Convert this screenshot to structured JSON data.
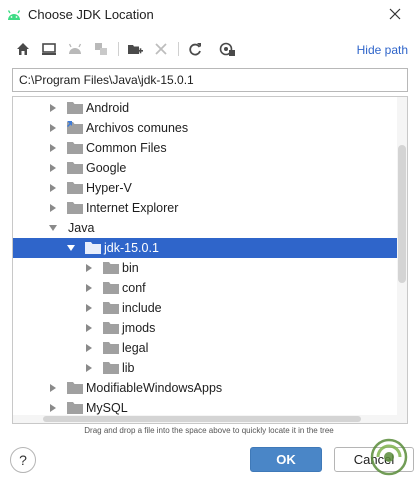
{
  "window": {
    "title": "Choose JDK Location"
  },
  "toolbar": {
    "hide_path_label": "Hide path"
  },
  "path": {
    "value": "C:\\Program Files\\Java\\jdk-15.0.1"
  },
  "tree": {
    "items": [
      {
        "label": "Android",
        "level": 1,
        "expanded": false,
        "selected": false
      },
      {
        "label": "Archivos comunes",
        "level": 1,
        "expanded": false,
        "selected": false,
        "shortcut": true
      },
      {
        "label": "Common Files",
        "level": 1,
        "expanded": false,
        "selected": false
      },
      {
        "label": "Google",
        "level": 1,
        "expanded": false,
        "selected": false
      },
      {
        "label": "Hyper-V",
        "level": 1,
        "expanded": false,
        "selected": false
      },
      {
        "label": "Internet Explorer",
        "level": 1,
        "expanded": false,
        "selected": false
      },
      {
        "label": "Java",
        "level": 1,
        "expanded": true,
        "selected": false,
        "no_icon": true
      },
      {
        "label": "jdk-15.0.1",
        "level": 2,
        "expanded": true,
        "selected": true
      },
      {
        "label": "bin",
        "level": 3,
        "expanded": false,
        "selected": false
      },
      {
        "label": "conf",
        "level": 3,
        "expanded": false,
        "selected": false
      },
      {
        "label": "include",
        "level": 3,
        "expanded": false,
        "selected": false
      },
      {
        "label": "jmods",
        "level": 3,
        "expanded": false,
        "selected": false
      },
      {
        "label": "legal",
        "level": 3,
        "expanded": false,
        "selected": false
      },
      {
        "label": "lib",
        "level": 3,
        "expanded": false,
        "selected": false
      },
      {
        "label": "ModifiableWindowsApps",
        "level": 1,
        "expanded": false,
        "selected": false
      },
      {
        "label": "MySQL",
        "level": 1,
        "expanded": false,
        "selected": false
      }
    ]
  },
  "hint": {
    "text": "Drag and drop a file into the space above to quickly locate it in the tree"
  },
  "buttons": {
    "help": "?",
    "ok": "OK",
    "cancel": "Cancel"
  },
  "colors": {
    "accent": "#2f65ca",
    "ok": "#4a86c7",
    "link": "#2f65ca"
  }
}
